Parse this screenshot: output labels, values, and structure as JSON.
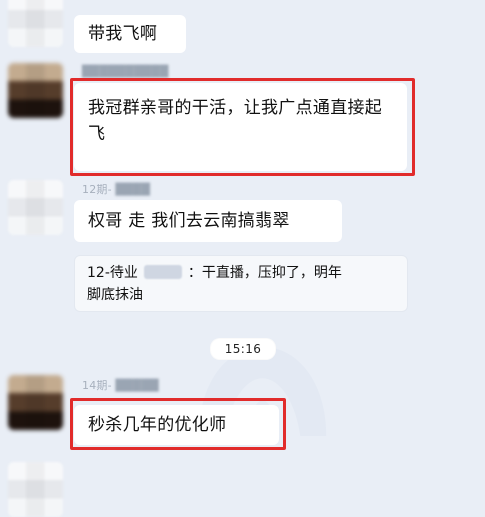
{
  "messages": [
    {
      "text": "带我飞啊"
    },
    {
      "sender_visible": "",
      "text": "我冠群亲哥的干活，让我广点通直接起飞"
    },
    {
      "sender_visible": "12期-",
      "text": "权哥 走 我们去云南搞翡翠",
      "quote": {
        "name": "12-待业",
        "text_line1": "：干直播，压抑了，明年",
        "text_line2": "脚底抹油"
      }
    },
    {
      "sender_visible": "14期-",
      "text": "秒杀几年的优化师"
    }
  ],
  "timestamp": "15:16",
  "colors": {
    "background": "#e9eef6",
    "bubble": "#ffffff",
    "highlight": "#e12b2b",
    "time_chip": "#ffffff",
    "quote_bg": "#f6f8fb"
  },
  "icons": {
    "watermark": "faded-logo-watermark"
  }
}
